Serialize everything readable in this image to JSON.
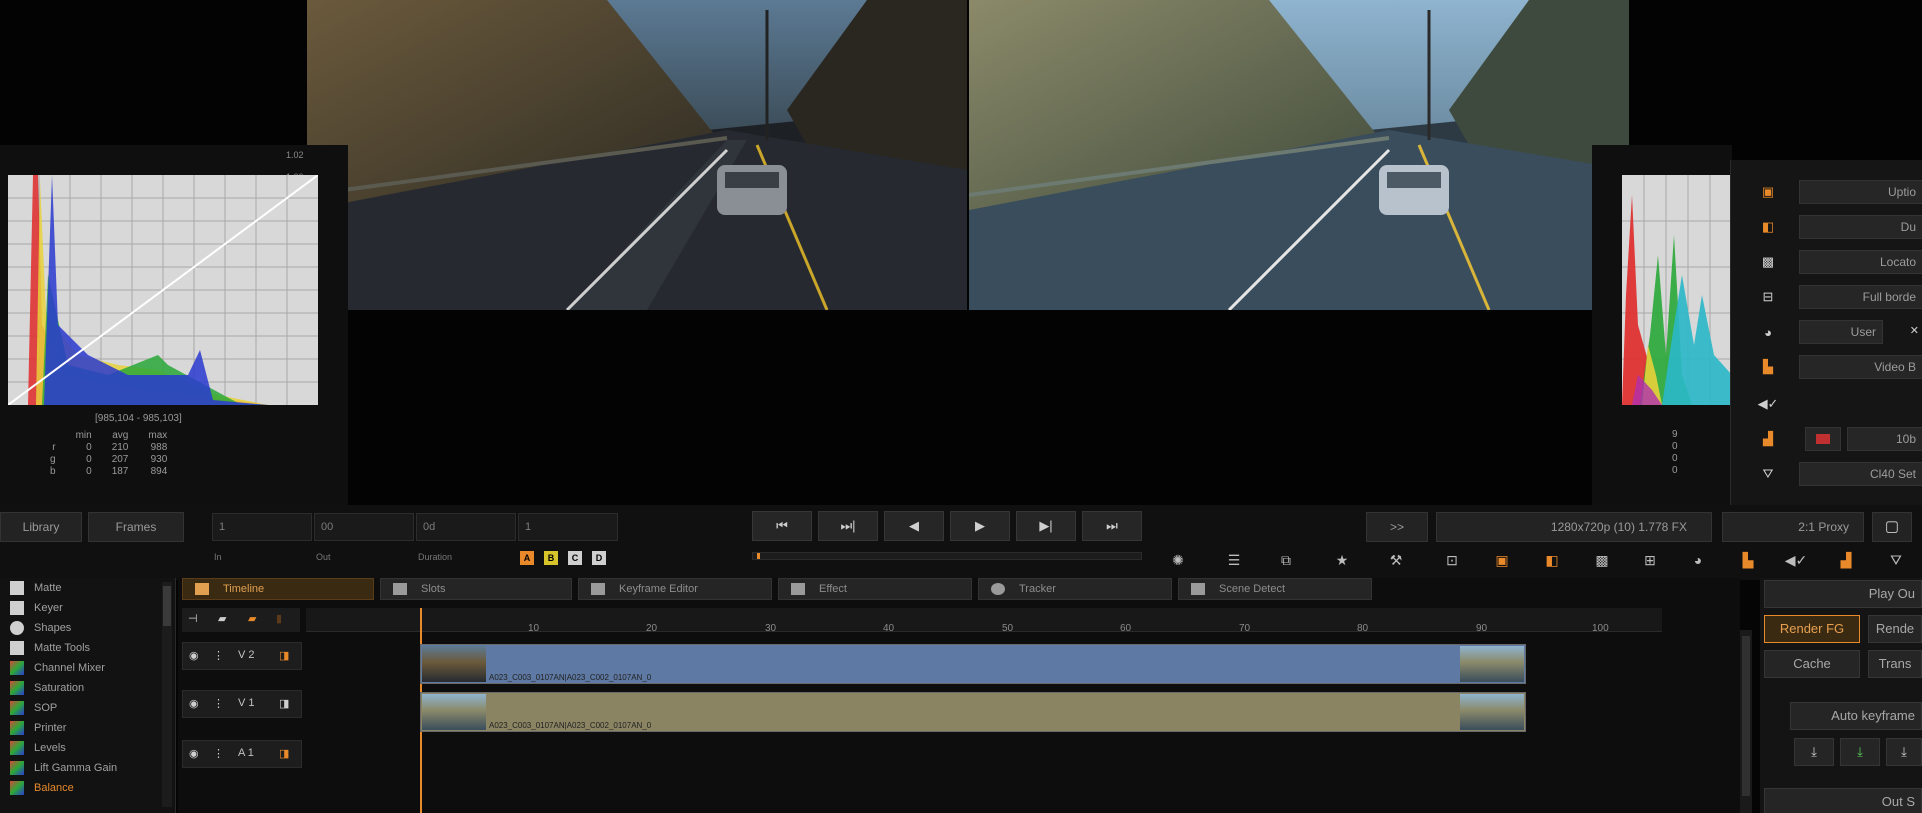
{
  "viewer": {
    "left_histogram": {
      "curve_top_labels": [
        "1.02",
        "1.00"
      ],
      "coord": "[985,104 - 985,103]",
      "headers": [
        "min",
        "avg",
        "max"
      ],
      "rows": [
        {
          "ch": "r",
          "min": "0",
          "avg": "210",
          "max": "988"
        },
        {
          "ch": "g",
          "min": "0",
          "avg": "207",
          "max": "930"
        },
        {
          "ch": "b",
          "min": "0",
          "avg": "187",
          "max": "894"
        }
      ]
    },
    "right_histogram": {
      "rows": [
        "0",
        "0",
        "0"
      ],
      "row_label_top": "9"
    }
  },
  "tool_panel": {
    "items": [
      {
        "icon": "compare-icon",
        "label": "Uptio",
        "color": "#e8892a"
      },
      {
        "icon": "split-icon",
        "label": "Du",
        "color": "#e8892a"
      },
      {
        "icon": "frame-icon",
        "label": "Locato",
        "color": "#cfcfcf"
      },
      {
        "icon": "safe-area-icon",
        "label": "Full borde",
        "color": "#cfcfcf"
      },
      {
        "icon": "color-wheel-icon",
        "label": "User",
        "color": "#cfcfcf"
      },
      {
        "icon": "histogram-icon",
        "label": "Video B",
        "color": "#e8892a"
      },
      {
        "icon": "audio-icon",
        "label": "",
        "color": "#cfcfcf"
      },
      {
        "icon": "scope-icon",
        "label": "10b",
        "color": "#e8892a"
      },
      {
        "icon": "node-icon",
        "label": "Cl40 Set",
        "color": "#cfcfcf"
      }
    ]
  },
  "transport": {
    "library_label": "Library",
    "frames_label": "Frames",
    "fields": [
      {
        "value": "1",
        "label": "In"
      },
      {
        "value": "00",
        "label": "Out"
      },
      {
        "value": "0d",
        "label": "Duration"
      },
      {
        "value": "1",
        "label": ""
      }
    ],
    "tags": [
      {
        "text": "A",
        "color": "#e8892a"
      },
      {
        "text": "B",
        "color": "#d7c32a"
      },
      {
        "text": "C",
        "color": "#cfcfcf"
      },
      {
        "text": "D",
        "color": "#cfcfcf"
      }
    ],
    "buttons": [
      "⏮",
      "⏭|",
      "◀",
      "▶",
      "▶|",
      "⏭"
    ],
    "fwd_label": ">>",
    "resolution": "1280x720p (10) 1.778 FX",
    "proxy": "2:1 Proxy"
  },
  "node_list": {
    "items": [
      {
        "label": "Matte",
        "color": "#cfcfcf"
      },
      {
        "label": "Keyer",
        "color": "#cfcfcf"
      },
      {
        "label": "Shapes",
        "color": "#cfcfcf"
      },
      {
        "label": "Matte Tools",
        "color": "#cfcfcf"
      },
      {
        "label": "Channel Mixer",
        "color": "#d24a3a"
      },
      {
        "label": "Saturation",
        "color": "#d24a3a"
      },
      {
        "label": "SOP",
        "color": "#d24a3a"
      },
      {
        "label": "Printer",
        "color": "#d24a3a"
      },
      {
        "label": "Levels",
        "color": "#d24a3a"
      },
      {
        "label": "Lift Gamma Gain",
        "color": "#d24a3a"
      },
      {
        "label": "Balance",
        "color": "#e8892a"
      }
    ]
  },
  "timeline": {
    "tabs": [
      {
        "label": "Timeline",
        "active": true
      },
      {
        "label": "Slots",
        "active": false
      },
      {
        "label": "Keyframe Editor",
        "active": false
      },
      {
        "label": "Effect",
        "active": false
      },
      {
        "label": "Tracker",
        "active": false
      },
      {
        "label": "Scene Detect",
        "active": false
      }
    ],
    "ruler": [
      "10",
      "20",
      "30",
      "40",
      "50",
      "60",
      "70",
      "80",
      "90",
      "100"
    ],
    "tracks": [
      {
        "name": "V 2",
        "clip": "A023_C003_0107AN|A023_C002_0107AN_0",
        "color": "#5e79a3"
      },
      {
        "name": "V 1",
        "clip": "A023_C003_0107AN|A023_C002_0107AN_0",
        "color": "#8a8463"
      },
      {
        "name": "A 1",
        "clip": "",
        "color": ""
      }
    ]
  },
  "render_panel": {
    "play_label": "Play Ou",
    "render_fg": "Render FG",
    "render_b": "Rende",
    "cache": "Cache",
    "trans": "Trans",
    "auto_keyframe": "Auto keyframe",
    "bottom_label": "Out S"
  },
  "colors": {
    "accent": "#e8892a",
    "clip_v2": "#5e79a3",
    "clip_v1": "#8a8463"
  }
}
